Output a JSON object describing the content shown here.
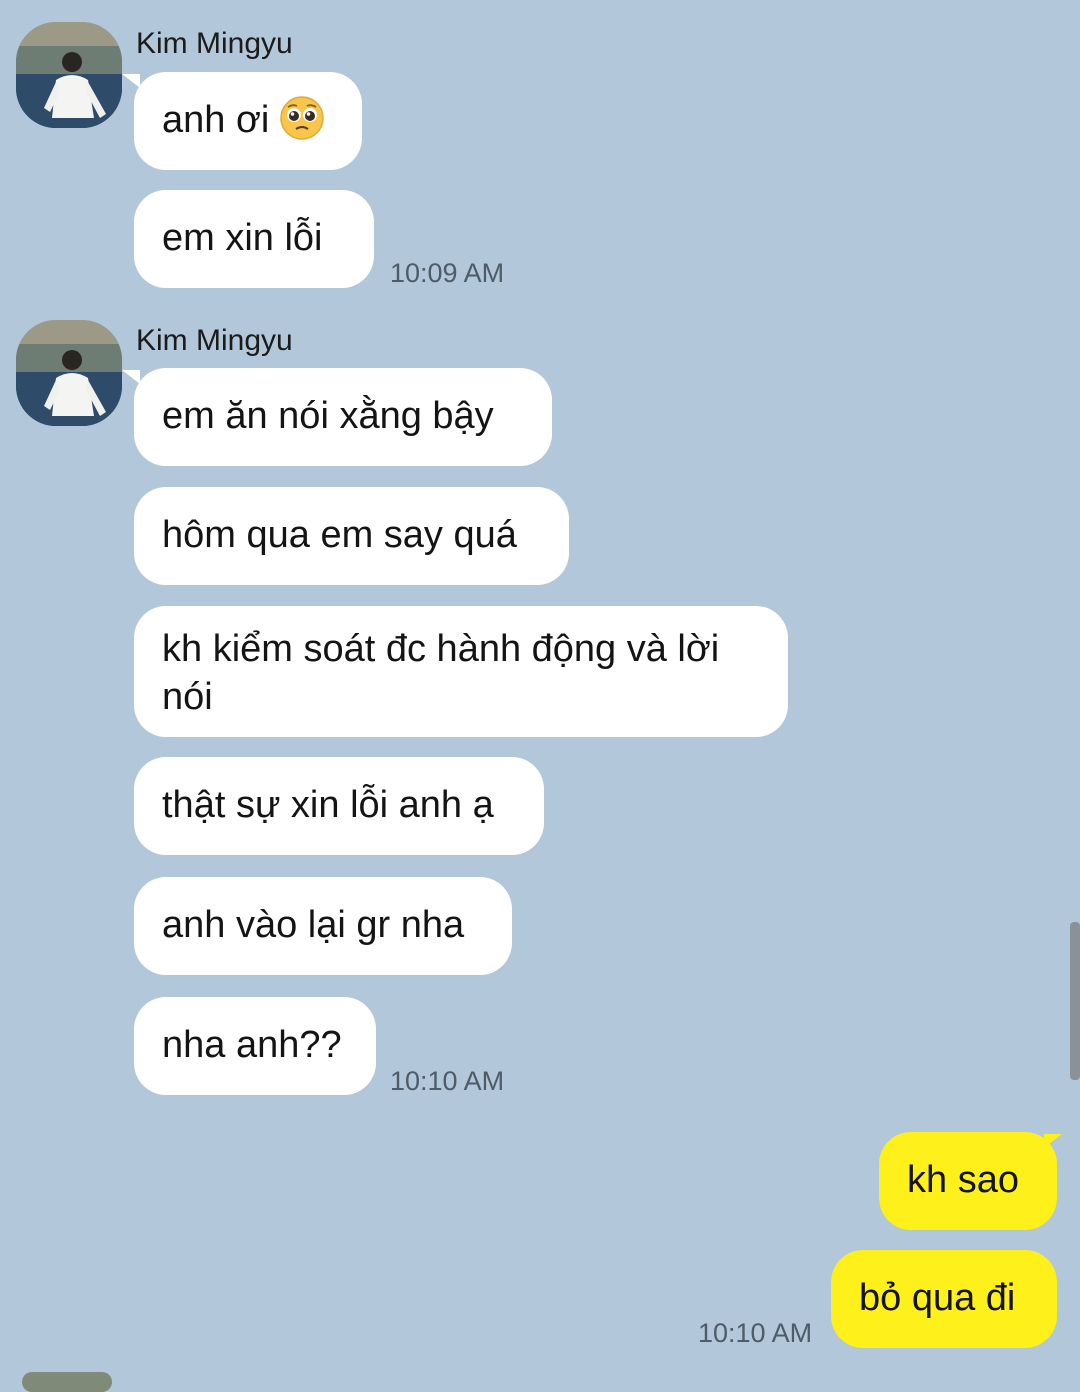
{
  "chat": {
    "group1": {
      "sender": "Kim Mingyu",
      "messages": [
        "anh ơi",
        "em xin lỗi"
      ],
      "emoji": "pleading-face-emoji",
      "time": "10:09 AM"
    },
    "group2": {
      "sender": "Kim Mingyu",
      "messages": [
        "em ăn nói xằng bậy",
        "hôm qua em say quá",
        "kh kiểm soát đc hành động và lời nói",
        "thật sự xin lỗi anh ạ",
        "anh vào lại gr nha",
        "nha anh??"
      ],
      "time": "10:10 AM"
    },
    "group3": {
      "messages": [
        "kh sao",
        "bỏ qua đi"
      ],
      "time": "10:10 AM"
    }
  },
  "colors": {
    "background": "#b2c7d9",
    "incoming_bubble": "#ffffff",
    "outgoing_bubble": "#fef01b",
    "timestamp": "#4e5c68"
  }
}
